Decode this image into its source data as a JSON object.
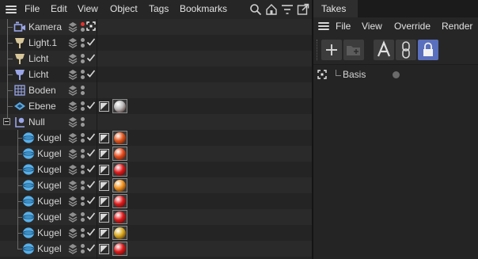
{
  "object_manager": {
    "menu": [
      "File",
      "Edit",
      "View",
      "Object",
      "Tags",
      "Bookmarks"
    ],
    "toolbar_icons": [
      "search-icon",
      "home-icon",
      "filter-icon",
      "expand-window-icon"
    ],
    "objects": [
      {
        "name": "Kamera",
        "icon": "camera-icon",
        "color": "#9aa6e8",
        "dots": "red",
        "check": "target",
        "material": null
      },
      {
        "name": "Light.1",
        "icon": "light-icon",
        "color": "#d8c79a",
        "dots": "gray",
        "check": "check",
        "material": null
      },
      {
        "name": "Licht",
        "icon": "light-icon",
        "color": "#d8c79a",
        "dots": "gray",
        "check": "check",
        "material": null
      },
      {
        "name": "Licht",
        "icon": "light-icon",
        "color": "#9aa6e8",
        "dots": "gray",
        "check": "check",
        "material": null
      },
      {
        "name": "Boden",
        "icon": "floor-icon",
        "color": "#9aa6e8",
        "dots": "gray",
        "check": null,
        "material": null
      },
      {
        "name": "Ebene",
        "icon": "plane-icon",
        "color": "#5aa7e0",
        "dots": "gray",
        "check": "check",
        "material": "#b8b8b8"
      },
      {
        "name": "Null",
        "icon": "null-icon",
        "color": "#9aa6e8",
        "dots": "gray",
        "check": null,
        "material": null
      },
      {
        "name": "Kugel",
        "icon": "sphere-icon",
        "color": "#5ab0e8",
        "dots": "gray",
        "check": "check",
        "material": "#e2541a"
      },
      {
        "name": "Kugel",
        "icon": "sphere-icon",
        "color": "#5ab0e8",
        "dots": "gray",
        "check": "check",
        "material": "#e84a1a"
      },
      {
        "name": "Kugel",
        "icon": "sphere-icon",
        "color": "#5ab0e8",
        "dots": "gray",
        "check": "check",
        "material": "#e0181a"
      },
      {
        "name": "Kugel",
        "icon": "sphere-icon",
        "color": "#5ab0e8",
        "dots": "gray",
        "check": "check",
        "material": "#f0901a"
      },
      {
        "name": "Kugel",
        "icon": "sphere-icon",
        "color": "#5ab0e8",
        "dots": "gray",
        "check": "check",
        "material": "#e0181a"
      },
      {
        "name": "Kugel",
        "icon": "sphere-icon",
        "color": "#5ab0e8",
        "dots": "gray",
        "check": "check",
        "material": "#e0181a"
      },
      {
        "name": "Kugel",
        "icon": "sphere-icon",
        "color": "#5ab0e8",
        "dots": "gray",
        "check": "check",
        "material": "#d8a81a"
      },
      {
        "name": "Kugel",
        "icon": "sphere-icon",
        "color": "#5ab0e8",
        "dots": "gray",
        "check": "check",
        "material": "#e0181a"
      }
    ]
  },
  "takes": {
    "tab_label": "Takes",
    "menu": [
      "File",
      "View",
      "Override",
      "Render"
    ],
    "toolbar_icons": [
      "add-take-icon",
      "add-folder-icon",
      "auto-take-icon",
      "link-icon",
      "lock-icon"
    ],
    "lock_active_color": "#5a6fbd",
    "items": [
      {
        "name": "Basis",
        "icon": "target-icon"
      }
    ]
  }
}
